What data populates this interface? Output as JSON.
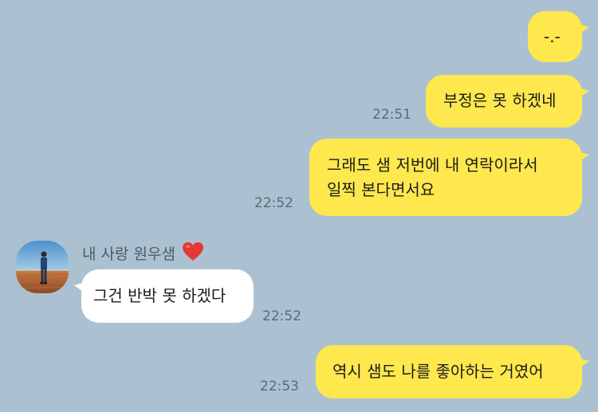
{
  "chat": {
    "messages": [
      {
        "text": "-.-"
      },
      {
        "text": "부정은 못 하겠네",
        "time": "22:51"
      },
      {
        "line1": "그래도 샘 저번에 내 연락이라서",
        "line2": "일찍 본다면서요",
        "time": "22:52"
      },
      {
        "text": "그건 반박 못 하겠다",
        "time": "22:52"
      },
      {
        "text": "역시 샘도 나를 좋아하는 거였어",
        "time": "22:53"
      }
    ],
    "contact": {
      "name": "내 사랑 원우샘",
      "heart_icon": "heart-icon",
      "avatar_icon": "person-photo"
    }
  },
  "colors": {
    "background": "#abc1d1",
    "my_bubble": "#fee84d",
    "their_bubble": "#ffffff",
    "heart": "#e53935"
  }
}
